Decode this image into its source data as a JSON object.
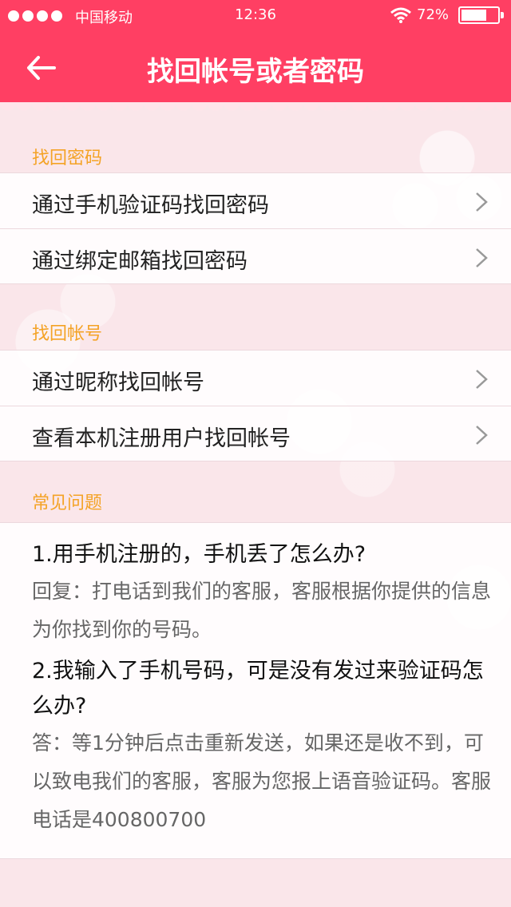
{
  "status_bar": {
    "carrier": "中国移动",
    "time": "12:36",
    "battery": "72%",
    "battery_level": 0.72
  },
  "header": {
    "title": "找回帐号或者密码",
    "back_icon": "back-arrow-icon",
    "color": "#ff3f63"
  },
  "sections": {
    "password": {
      "label": "找回密码",
      "items": [
        {
          "label": "通过手机验证码找回密码"
        },
        {
          "label": "通过绑定邮箱找回密码"
        }
      ]
    },
    "account": {
      "label": "找回帐号",
      "items": [
        {
          "label": "通过昵称找回帐号"
        },
        {
          "label": "查看本机注册用户找回帐号"
        }
      ]
    },
    "faq": {
      "label": "常见问题",
      "items": [
        {
          "question": "1.用手机注册的，手机丢了怎么办?",
          "answer": "回复：打电话到我们的客服，客服根据你提供的信息为你找到你的号码。"
        },
        {
          "question": "2.我输入了手机号码，可是没有发过来验证码怎么办?",
          "answer": "答：等1分钟后点击重新发送，如果还是收不到，可以致电我们的客服，客服为您报上语音验证码。客服电话是400800700"
        }
      ]
    }
  },
  "colors": {
    "accent": "#ff3f63",
    "section_label": "#f4a326"
  }
}
